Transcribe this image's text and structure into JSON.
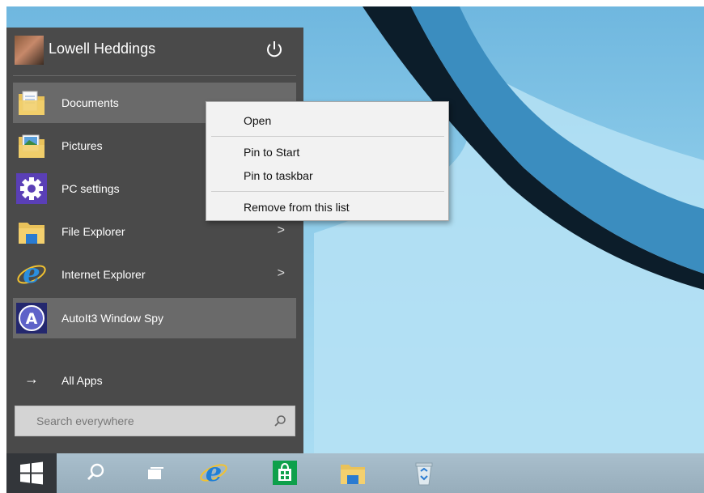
{
  "user": {
    "name": "Lowell Heddings"
  },
  "start_menu": {
    "items": [
      {
        "label": "Documents",
        "icon": "documents-folder-icon",
        "arrow": ""
      },
      {
        "label": "Pictures",
        "icon": "pictures-folder-icon",
        "arrow": ""
      },
      {
        "label": "PC settings",
        "icon": "gear-icon",
        "arrow": ""
      },
      {
        "label": "File Explorer",
        "icon": "file-explorer-icon",
        "arrow": ">"
      },
      {
        "label": "Internet Explorer",
        "icon": "internet-explorer-icon",
        "arrow": ">"
      },
      {
        "label": "AutoIt3 Window Spy",
        "icon": "autoit-icon",
        "arrow": ""
      }
    ],
    "all_apps": {
      "label": "All Apps",
      "arrow": "→"
    },
    "search": {
      "placeholder": "Search everywhere"
    }
  },
  "context_menu": {
    "items": [
      {
        "label": "Open"
      },
      {
        "label": "Pin to Start"
      },
      {
        "label": "Pin to taskbar"
      },
      {
        "label": "Remove from this list"
      }
    ]
  },
  "taskbar": {
    "icons": [
      "windows-start-icon",
      "search-icon",
      "task-view-icon",
      "internet-explorer-icon",
      "store-icon",
      "file-explorer-icon",
      "recycle-bin-icon"
    ]
  },
  "colors": {
    "start_menu_bg": "#4a4a4a",
    "highlight": "#6a6a6a",
    "desktop": "#8ccbe9",
    "taskbar": "#a9bfcd"
  }
}
